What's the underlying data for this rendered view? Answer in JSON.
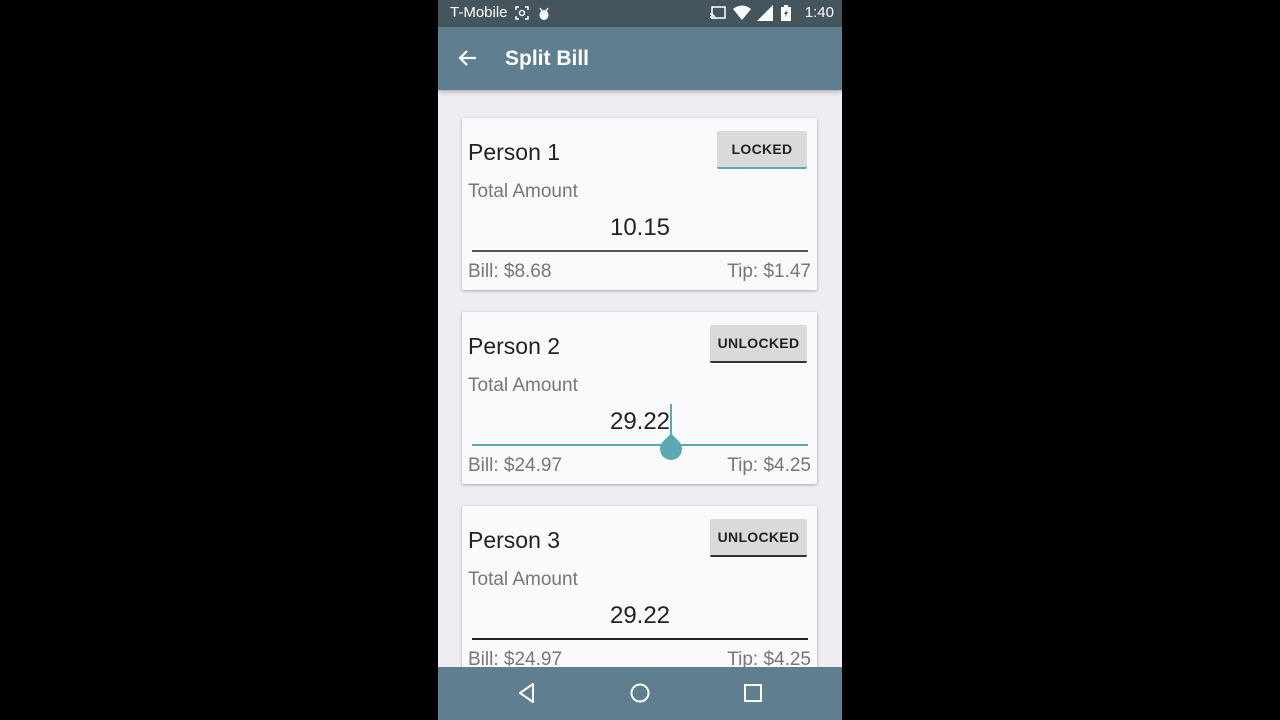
{
  "status_bar": {
    "carrier": "T-Mobile",
    "time": "1:40",
    "icons": [
      "cast-icon",
      "wifi-icon",
      "signal-icon",
      "battery-charging-icon"
    ]
  },
  "app_bar": {
    "title": "Split Bill",
    "back_icon": "arrow-back-icon"
  },
  "people": [
    {
      "name": "Person 1",
      "lock_label": "LOCKED",
      "total_label": "Total Amount",
      "amount": "10.15",
      "bill": "Bill:  $8.68",
      "tip": "Tip:  $1.47"
    },
    {
      "name": "Person 2",
      "lock_label": "UNLOCKED",
      "total_label": "Total Amount",
      "amount": "29.22",
      "bill": "Bill:  $24.97",
      "tip": "Tip:  $4.25"
    },
    {
      "name": "Person 3",
      "lock_label": "UNLOCKED",
      "total_label": "Total Amount",
      "amount": "29.22",
      "bill": "Bill:  $24.97",
      "tip": "Tip:  $4.25"
    }
  ],
  "nav_bar": {
    "icons": [
      "back-triangle-icon",
      "home-circle-icon",
      "recents-square-icon"
    ]
  },
  "colors": {
    "status_bar": "#45555d",
    "app_bar": "#5f7f91",
    "accent": "#5aaab0",
    "background": "#eeeef2"
  }
}
